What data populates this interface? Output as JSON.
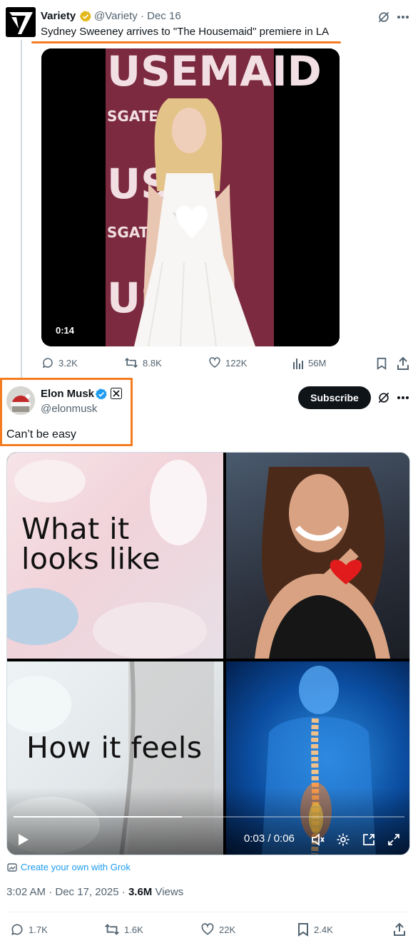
{
  "quoted_tweet": {
    "author_name": "Variety",
    "handle_date": "@Variety · Dec 16",
    "text": "Sydney Sweeney arrives to \"The Housemaid\" premiere in LA",
    "video_duration": "0:14",
    "backdrop_words": [
      "USEMAID",
      "SGATE",
      "USE",
      "SGAT",
      "USE"
    ],
    "stats": {
      "replies": "3.2K",
      "reposts": "8.8K",
      "likes": "122K",
      "views": "56M"
    }
  },
  "main_tweet": {
    "author_name": "Elon Musk",
    "handle": "@elonmusk",
    "subscribe_label": "Subscribe",
    "text": "Can’t be easy",
    "media": {
      "top_text": "What it looks like",
      "top_text_lines": [
        "What it",
        "looks like"
      ],
      "bottom_text": "How it feels",
      "time_readout": "0:03 / 0:06",
      "progress": 0.43
    },
    "grok_label": "Create your own with Grok",
    "timestamp_prefix": "3:02 AM · Dec 17, 2025 · ",
    "views_count": "3.6M",
    "views_label": " Views",
    "stats": {
      "replies": "1.7K",
      "reposts": "1.6K",
      "likes": "22K",
      "bookmarks": "2.4K"
    }
  },
  "colors": {
    "accent_orange": "#f47c20",
    "verified_blue": "#1d9bf0",
    "gold_check": "#e2b719",
    "text": "#0f1419",
    "muted": "#536471"
  }
}
